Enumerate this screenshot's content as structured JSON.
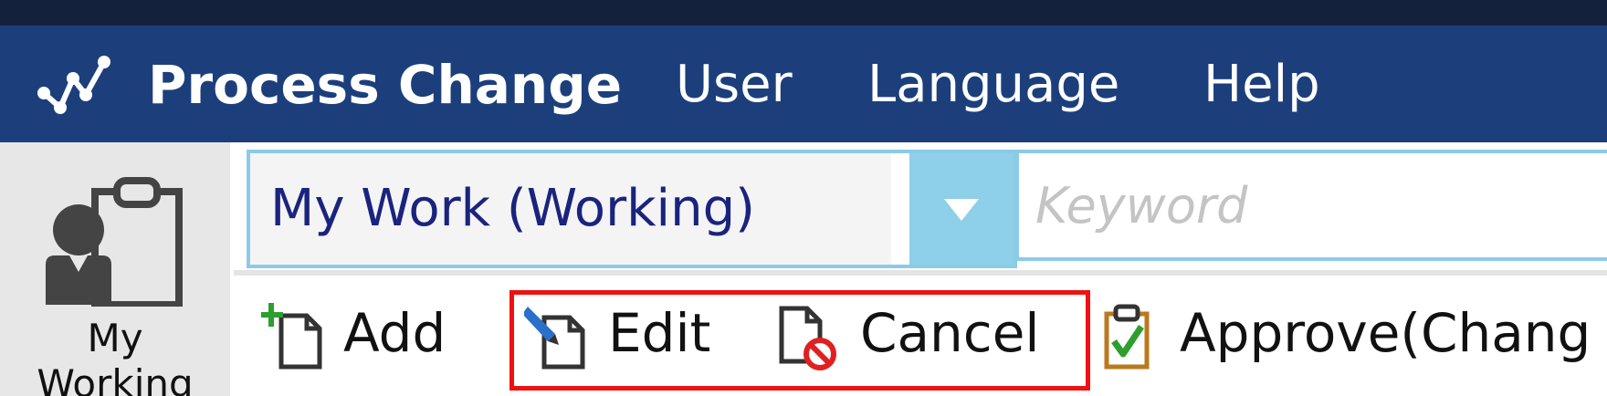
{
  "app": {
    "title": "Process Change",
    "logo_icon": "line-chart-icon"
  },
  "menu": {
    "items": [
      "User",
      "Language",
      "Help"
    ]
  },
  "sidebar": {
    "item_icon": "user-clipboard-icon",
    "item_label_line1": "My",
    "item_label_line2": "Working"
  },
  "filter": {
    "selected_view": "My Work (Working)",
    "keyword_placeholder": "Keyword",
    "keyword_value": ""
  },
  "toolbar": {
    "buttons": [
      {
        "label": "Add",
        "icon": "add-document-icon"
      },
      {
        "label": "Edit",
        "icon": "edit-document-icon"
      },
      {
        "label": "Cancel",
        "icon": "cancel-document-icon"
      },
      {
        "label": "Approve(Chang",
        "icon": "approve-clipboard-icon"
      }
    ]
  },
  "colors": {
    "titlebar": "#14213d",
    "menubar": "#1c3f7c",
    "accent_light_blue": "#8ecfea",
    "dropdown_text": "#1a237e",
    "highlight": "#ee1111"
  }
}
